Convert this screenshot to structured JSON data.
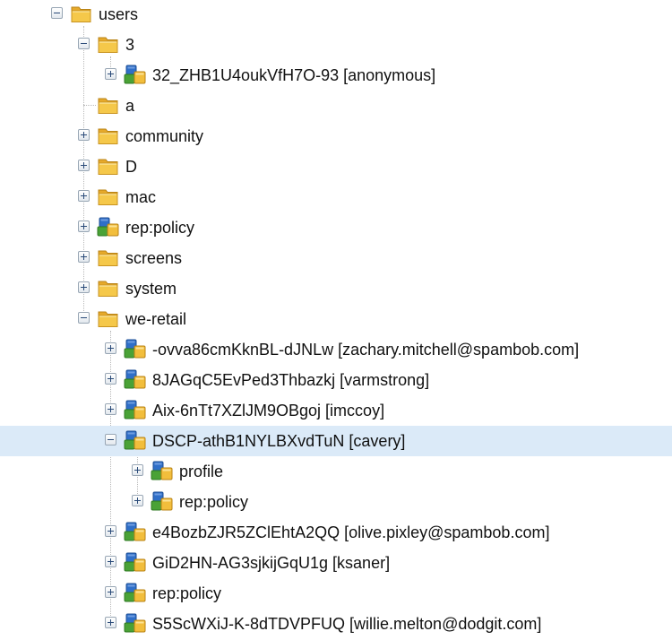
{
  "tree": {
    "nodes": [
      {
        "label": "users",
        "icon": "folder-icon",
        "toggle": "expanded",
        "level": 0
      },
      {
        "label": "3",
        "icon": "folder-icon",
        "toggle": "expanded",
        "level": 1
      },
      {
        "label": "32_ZHB1U4oukVfH7O-93 [anonymous]",
        "icon": "user-node-icon",
        "toggle": "collapsed",
        "level": 2
      },
      {
        "label": "a",
        "icon": "folder-icon",
        "toggle": "none",
        "level": 1
      },
      {
        "label": "community",
        "icon": "folder-icon",
        "toggle": "collapsed",
        "level": 1
      },
      {
        "label": "D",
        "icon": "folder-icon",
        "toggle": "collapsed",
        "level": 1
      },
      {
        "label": "mac",
        "icon": "folder-icon",
        "toggle": "collapsed",
        "level": 1
      },
      {
        "label": "rep:policy",
        "icon": "user-node-icon",
        "toggle": "collapsed",
        "level": 1
      },
      {
        "label": "screens",
        "icon": "folder-icon",
        "toggle": "collapsed",
        "level": 1
      },
      {
        "label": "system",
        "icon": "folder-icon",
        "toggle": "collapsed",
        "level": 1
      },
      {
        "label": "we-retail",
        "icon": "folder-icon",
        "toggle": "expanded",
        "level": 1
      },
      {
        "label": "-ovva86cmKknBL-dJNLw [zachary.mitchell@spambob.com]",
        "icon": "user-node-icon",
        "toggle": "collapsed",
        "level": 2
      },
      {
        "label": "8JAGqC5EvPed3Thbazkj [varmstrong]",
        "icon": "user-node-icon",
        "toggle": "collapsed",
        "level": 2
      },
      {
        "label": "Aix-6nTt7XZlJM9OBgoj [imccoy]",
        "icon": "user-node-icon",
        "toggle": "collapsed",
        "level": 2
      },
      {
        "label": "DSCP-athB1NYLBXvdTuN [cavery]",
        "icon": "user-node-icon",
        "toggle": "expanded",
        "level": 2,
        "selected": true
      },
      {
        "label": "profile",
        "icon": "user-node-icon",
        "toggle": "collapsed",
        "level": 3
      },
      {
        "label": "rep:policy",
        "icon": "user-node-icon",
        "toggle": "collapsed",
        "level": 3
      },
      {
        "label": "e4BozbZJR5ZClEhtA2QQ [olive.pixley@spambob.com]",
        "icon": "user-node-icon",
        "toggle": "collapsed",
        "level": 2
      },
      {
        "label": "GiD2HN-AG3sjkijGqU1g [ksaner]",
        "icon": "user-node-icon",
        "toggle": "collapsed",
        "level": 2
      },
      {
        "label": "rep:policy",
        "icon": "user-node-icon",
        "toggle": "collapsed",
        "level": 2
      },
      {
        "label": "S5ScWXiJ-K-8dTDVPFUQ [willie.melton@dodgit.com]",
        "icon": "user-node-icon",
        "toggle": "collapsed",
        "level": 2
      }
    ]
  },
  "colors": {
    "selected_row": "#dbeaf8",
    "folder": "#f2be3c",
    "user_node_blue": "#2f6fc8",
    "user_node_green": "#4aa236",
    "user_node_gold": "#f2be3c"
  }
}
